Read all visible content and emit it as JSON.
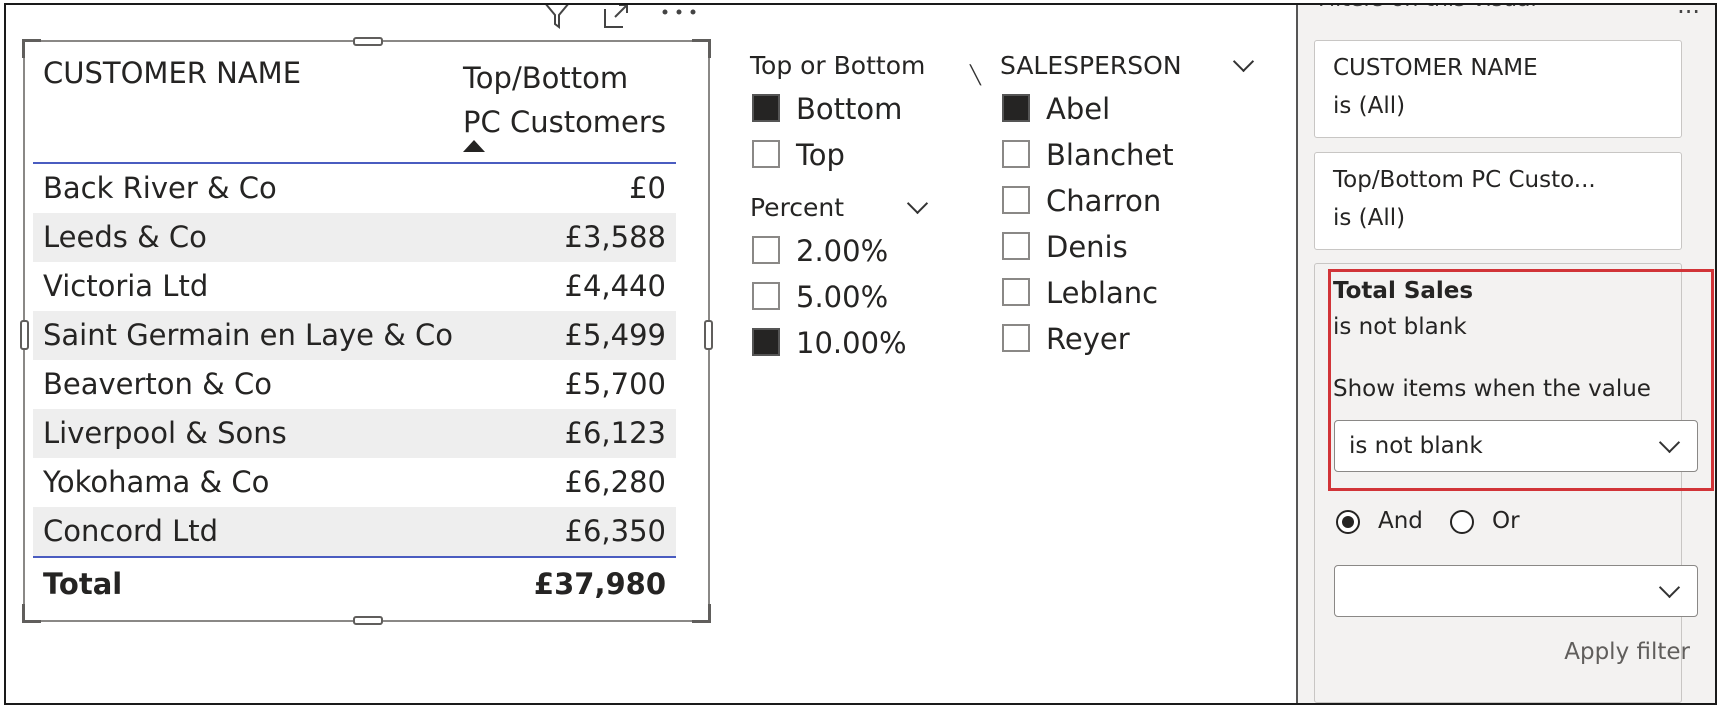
{
  "table_visual": {
    "header_icons": [
      "filter-icon",
      "focus-mode-icon",
      "more-options-icon"
    ],
    "columns": [
      "CUSTOMER NAME",
      "Top/Bottom\nPC Customers"
    ],
    "column_lines": [
      "Top/Bottom",
      "PC Customers"
    ],
    "rows": [
      {
        "name": "Back River & Co",
        "value": "£0"
      },
      {
        "name": "Leeds & Co",
        "value": "£3,588"
      },
      {
        "name": "Victoria Ltd",
        "value": "£4,440"
      },
      {
        "name": "Saint Germain en Laye & Co",
        "value": "£5,499"
      },
      {
        "name": "Beaverton & Co",
        "value": "£5,700"
      },
      {
        "name": "Liverpool & Sons",
        "value": "£6,123"
      },
      {
        "name": "Yokohama & Co",
        "value": "£6,280"
      },
      {
        "name": "Concord Ltd",
        "value": "£6,350"
      }
    ],
    "total": {
      "label": "Total",
      "value": "£37,980"
    }
  },
  "slicer_top_bottom": {
    "title": "Top or Bottom",
    "options": [
      {
        "label": "Bottom",
        "checked": true
      },
      {
        "label": "Top",
        "checked": false
      }
    ]
  },
  "slicer_percent": {
    "title": "Percent",
    "options": [
      {
        "label": "2.00%",
        "checked": false
      },
      {
        "label": "5.00%",
        "checked": false
      },
      {
        "label": "10.00%",
        "checked": true
      }
    ]
  },
  "slicer_salesperson": {
    "title": "SALESPERSON",
    "options": [
      {
        "label": "Abel",
        "checked": true
      },
      {
        "label": "Blanchet",
        "checked": false
      },
      {
        "label": "Charron",
        "checked": false
      },
      {
        "label": "Denis",
        "checked": false
      },
      {
        "label": "Leblanc",
        "checked": false
      },
      {
        "label": "Reyer",
        "checked": false
      }
    ]
  },
  "filter_pane": {
    "title": "Filters on this visual",
    "more": "...",
    "cards": [
      {
        "title": "CUSTOMER NAME",
        "state": "is (All)"
      },
      {
        "title": "Top/Bottom PC Custo...",
        "state": "is (All)"
      }
    ],
    "active_card": {
      "title": "Total Sales",
      "state": "is not blank",
      "show_label": "Show items when the value",
      "condition_value": "is not blank",
      "and_label": "And",
      "or_label": "Or",
      "logic_selected": "And",
      "second_condition_value": "",
      "apply_label": "Apply filter"
    },
    "highlight_color": "#d13438"
  },
  "colors": {
    "accent_line": "#4a5cc0",
    "checked_box": "#252423"
  }
}
